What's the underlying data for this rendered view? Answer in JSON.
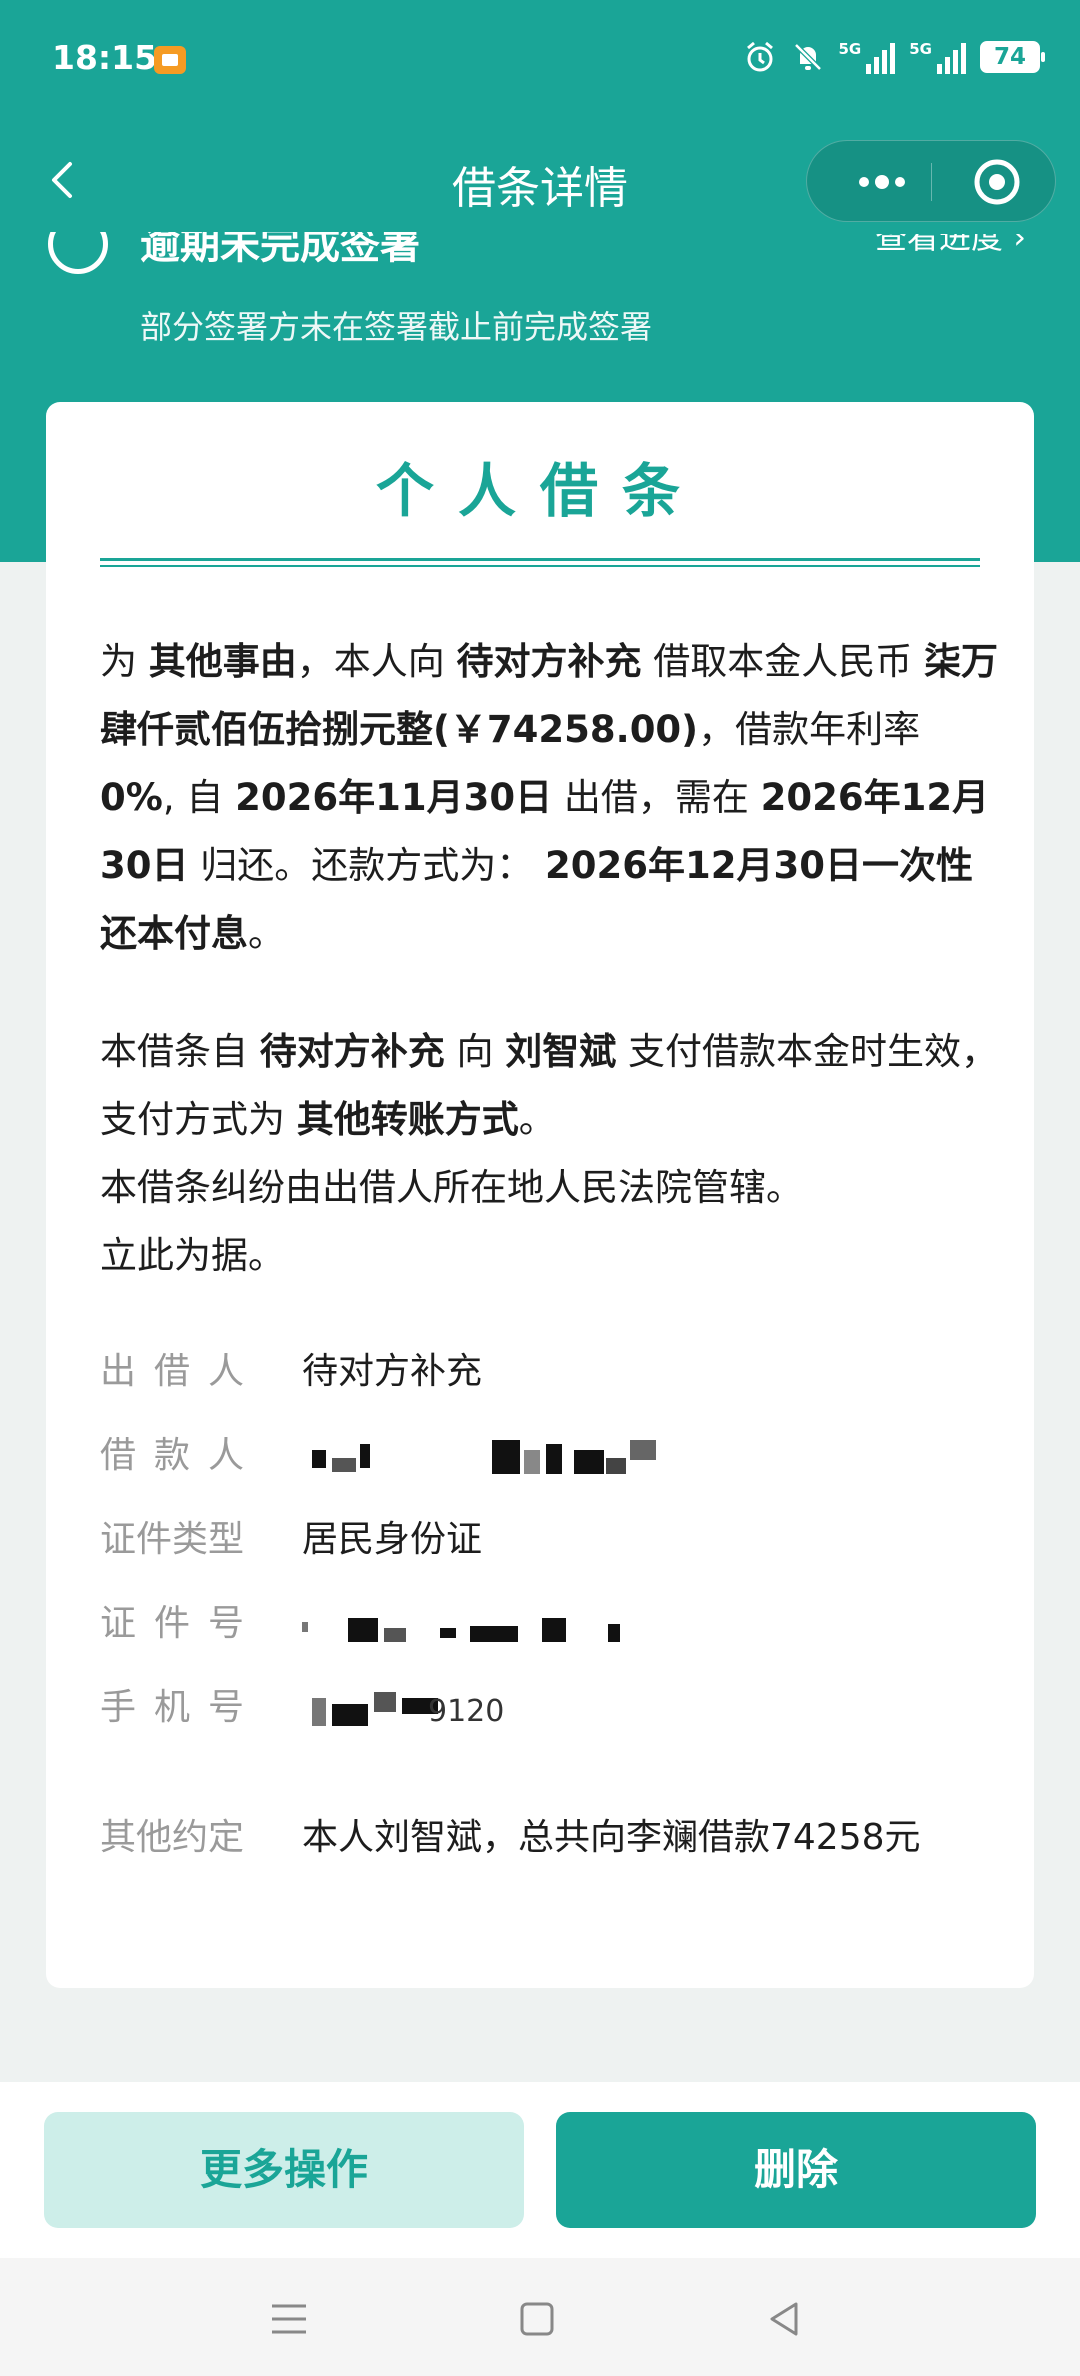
{
  "status_bar": {
    "time": "18:15",
    "signal1_label": "5G",
    "signal2_label": "5G",
    "battery": "74"
  },
  "nav": {
    "title": "借条详情"
  },
  "notice": {
    "title": "逾期未完成签署",
    "link": "查看进度 ›",
    "subtitle": "部分签署方未在签署截止前完成签署"
  },
  "document": {
    "title": "个人借条",
    "paragraph1": [
      {
        "t": "为 ",
        "b": false
      },
      {
        "t": "其他事由",
        "b": true
      },
      {
        "t": "，本人向 ",
        "b": false
      },
      {
        "t": "待对方补充",
        "b": true
      },
      {
        "t": " 借取本金人民币 ",
        "b": false
      },
      {
        "t": "柒万肆仟贰佰伍拾捌元整(￥74258.00)",
        "b": true
      },
      {
        "t": "，借款年利率 ",
        "b": false
      },
      {
        "t": "0%",
        "b": true
      },
      {
        "t": ", 自 ",
        "b": false
      },
      {
        "t": "2026年11月30日",
        "b": true
      },
      {
        "t": " 出借，需在 ",
        "b": false
      },
      {
        "t": "2026年12月30日",
        "b": true
      },
      {
        "t": " 归还。还款方式为： ",
        "b": false
      },
      {
        "t": "2026年12月30日一次性还本付息",
        "b": true
      },
      {
        "t": "。",
        "b": false
      }
    ],
    "paragraph2": [
      {
        "t": "本借条自 ",
        "b": false
      },
      {
        "t": "待对方补充",
        "b": true
      },
      {
        "t": " 向 ",
        "b": false
      },
      {
        "t": "刘智斌",
        "b": true
      },
      {
        "t": " 支付借款本金时生效，支付方式为 ",
        "b": false
      },
      {
        "t": "其他转账方式",
        "b": true
      },
      {
        "t": "。",
        "b": false
      }
    ],
    "paragraph3": "本借条纠纷由出借人所在地人民法院管辖。",
    "paragraph4": "立此为据。",
    "lender_label": "出借人",
    "lender_value": "待对方补充",
    "borrower_label": "借款人",
    "id_type_label": "证件类型",
    "id_type_value": "居民身份证",
    "id_number_label": "证件号",
    "phone_label": "手机号",
    "phone_visible_tail": "9120",
    "other_label": "其他约定",
    "other_value": "本人刘智斌，总共向李斓借款74258元"
  },
  "footer": {
    "more_label": "更多操作",
    "delete_label": "删除"
  },
  "colors": {
    "brand": "#1aa597",
    "light_brand": "#cdeee9"
  }
}
